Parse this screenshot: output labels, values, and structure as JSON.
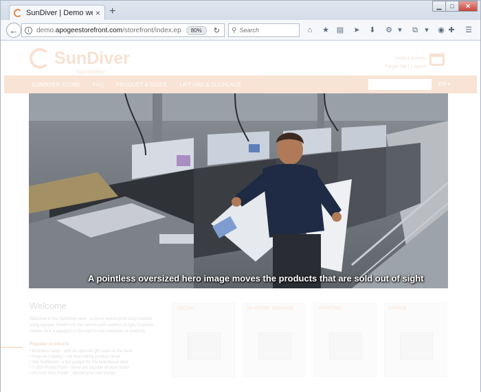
{
  "browser": {
    "tab_title": "SunDiver | Demo web-to-print",
    "tab_close": "×",
    "new_tab": "+",
    "url_prefix": "demo.",
    "url_domain": "apogeestorefront.com",
    "url_path": "/storefront/index.ep",
    "zoom": "80%",
    "search_placeholder": "Search",
    "accent_color": "#e07b39"
  },
  "site": {
    "logo_name": "SunDiver",
    "logo_sub": "SportsWear",
    "account_user": "Hello Laurens",
    "account_links": "Forget Me | Logout",
    "cart_count": "0",
    "menu": [
      "SUNDIVER STORE",
      "FAQ",
      "PRODUCT & GUIDE",
      "LIFT OAD & SUCHLAGE"
    ],
    "language": "EN ▾"
  },
  "hero": {
    "caption": "A pointless oversized hero image moves the products that are sold out of sight"
  },
  "welcome": {
    "title": "Welcome",
    "text": "Welcome to the SunDiver store - a demo web-to-print shop created using Apogee StoreFront, the web-to-print solution of Agfa Graphics. Please click a category to the right to see examples of products.",
    "popular_title": "Popular products",
    "popular": [
      "• Business cards - with an optional QR code on the back",
      "• Augusta Catalog - our best selling product range",
      "• Sky Surfboard - a fun gadget for the beachwear aisle",
      "• T-shirt Promo Flyer - these are popular all year round",
      "• All In All Size Poster - upload your own design"
    ]
  },
  "categories": [
    "SOCIAL",
    "IN-STORE SIGNAGE",
    "PRINTING",
    "OFFICE"
  ]
}
